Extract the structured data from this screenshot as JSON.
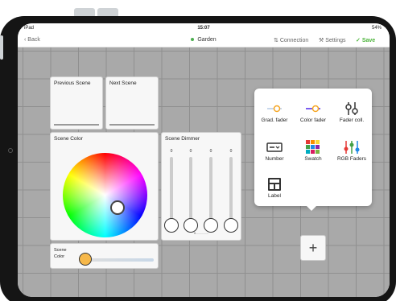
{
  "status_bar": {
    "device": "iPad",
    "time": "15:07",
    "battery": "54%"
  },
  "nav": {
    "back": "Back",
    "title": "Garden",
    "connection": "Connection",
    "settings": "Settings",
    "save": "Save"
  },
  "cards": {
    "previous_scene": "Previous Scene",
    "next_scene": "Next Scene",
    "scene_color": "Scene Color",
    "scene_dimmer": "Scene Dimmer",
    "scene_color_slider": "Scene Color"
  },
  "dimmer_values": [
    "0",
    "0",
    "0",
    "0"
  ],
  "dimmer_pager": "•········",
  "popup": {
    "items": [
      {
        "label": "Grad. fader",
        "icon": "gradient-fader-icon"
      },
      {
        "label": "Color fader",
        "icon": "color-fader-icon"
      },
      {
        "label": "Fader coll.",
        "icon": "fader-collection-icon"
      },
      {
        "label": "Number",
        "icon": "number-icon"
      },
      {
        "label": "Swatch",
        "icon": "swatch-icon"
      },
      {
        "label": "RGB Faders",
        "icon": "rgb-faders-icon"
      },
      {
        "label": "Label",
        "icon": "label-icon"
      }
    ]
  },
  "add_button": "+",
  "colors": {
    "accent": "#4cb43a",
    "slider_knob": "#f6b84a",
    "grid": "#a9a9a9"
  }
}
